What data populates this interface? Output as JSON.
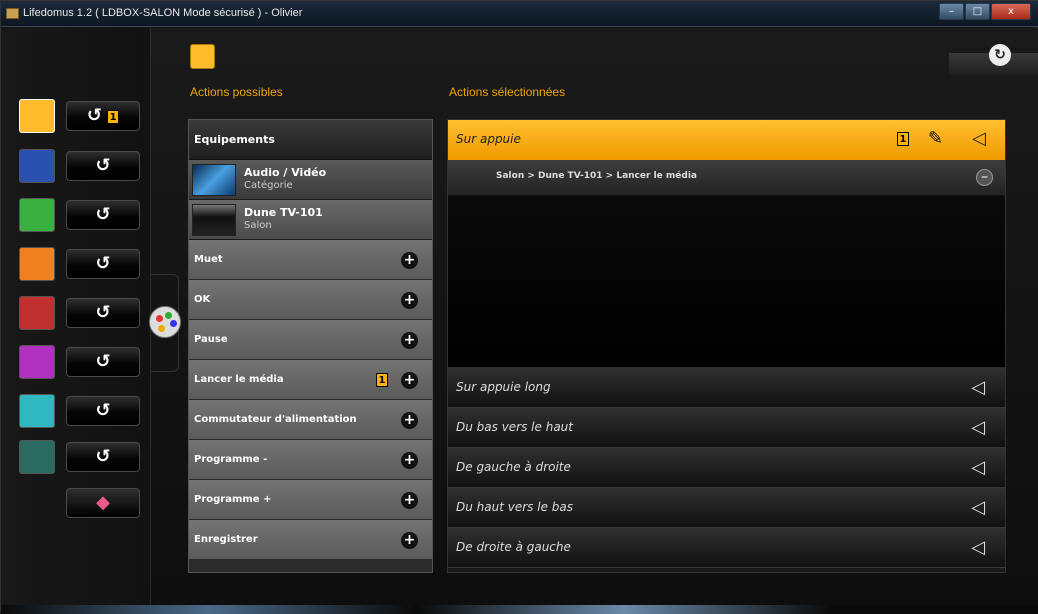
{
  "window": {
    "title": "Lifedomus 1.2 ( LDBOX-SALON Mode sécurisé ) - Olivier",
    "min": "–",
    "max": "□",
    "close": "x"
  },
  "colors": {
    "accent": "#ffb400",
    "swatches": [
      "#ffbb2a",
      "#2a50b0",
      "#3ab040",
      "#f08020",
      "#c03030",
      "#b030c0",
      "#30b8c0",
      "#2a6a60"
    ]
  },
  "left_column": {
    "gesture_icon": "↺",
    "first_badge": "1",
    "rows": [
      {
        "color": "#ffbb2a",
        "badge": "1"
      },
      {
        "color": "#2a50b0",
        "badge": ""
      },
      {
        "color": "#3ab040",
        "badge": ""
      },
      {
        "color": "#f08020",
        "badge": ""
      },
      {
        "color": "#c03030",
        "badge": ""
      },
      {
        "color": "#b030c0",
        "badge": ""
      },
      {
        "color": "#30b8c0",
        "badge": ""
      },
      {
        "color": "#2a6a60",
        "badge": ""
      }
    ]
  },
  "header": {
    "left_title": "Actions possibles",
    "right_title": "Actions sélectionnées"
  },
  "left_panel": {
    "header": "Equipements",
    "category": {
      "name": "Audio / Vidéo",
      "sub": "Catégorie"
    },
    "device": {
      "name": "Dune TV-101",
      "sub": "Salon"
    },
    "actions": [
      {
        "label": "Muet",
        "badge": ""
      },
      {
        "label": "OK",
        "badge": ""
      },
      {
        "label": "Pause",
        "badge": ""
      },
      {
        "label": "Lancer le média",
        "badge": "1"
      },
      {
        "label": "Commutateur d'alimentation",
        "badge": ""
      },
      {
        "label": "Programme -",
        "badge": ""
      },
      {
        "label": "Programme +",
        "badge": ""
      },
      {
        "label": "Enregistrer",
        "badge": ""
      }
    ],
    "plus": "+"
  },
  "right_panel": {
    "active": {
      "label": "Sur appuie",
      "badge": "1",
      "pencil": "✎",
      "speaker": "◁"
    },
    "selected_action": {
      "path": "Salon > Dune TV-101 > Lancer le média",
      "minus": "–"
    },
    "triggers": [
      {
        "label": "Sur appuie long",
        "speaker": "◁"
      },
      {
        "label": "Du bas vers le haut",
        "speaker": "◁"
      },
      {
        "label": "De gauche à droite",
        "speaker": "◁"
      },
      {
        "label": "Du haut vers le bas",
        "speaker": "◁"
      },
      {
        "label": "De droite à gauche",
        "speaker": "◁"
      }
    ]
  },
  "icons": {
    "refresh": "↻",
    "eraser": "◆"
  }
}
